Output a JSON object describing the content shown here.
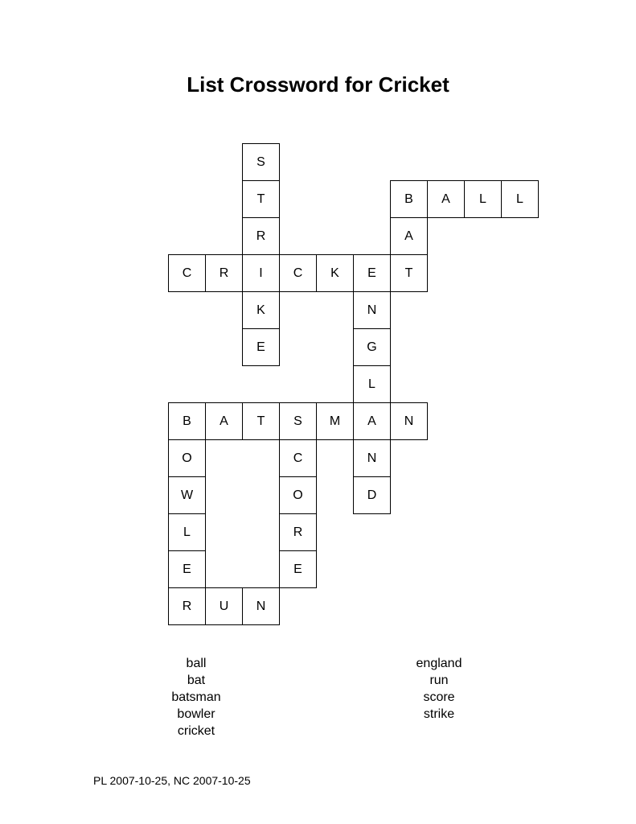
{
  "title": "List Crossword for Cricket",
  "cells": [
    {
      "r": 0,
      "c": 2,
      "letter": "S"
    },
    {
      "r": 1,
      "c": 2,
      "letter": "T"
    },
    {
      "r": 1,
      "c": 6,
      "letter": "B"
    },
    {
      "r": 1,
      "c": 7,
      "letter": "A"
    },
    {
      "r": 1,
      "c": 8,
      "letter": "L"
    },
    {
      "r": 1,
      "c": 9,
      "letter": "L"
    },
    {
      "r": 2,
      "c": 2,
      "letter": "R"
    },
    {
      "r": 2,
      "c": 6,
      "letter": "A"
    },
    {
      "r": 3,
      "c": 0,
      "letter": "C"
    },
    {
      "r": 3,
      "c": 1,
      "letter": "R"
    },
    {
      "r": 3,
      "c": 2,
      "letter": "I"
    },
    {
      "r": 3,
      "c": 3,
      "letter": "C"
    },
    {
      "r": 3,
      "c": 4,
      "letter": "K"
    },
    {
      "r": 3,
      "c": 5,
      "letter": "E"
    },
    {
      "r": 3,
      "c": 6,
      "letter": "T"
    },
    {
      "r": 4,
      "c": 2,
      "letter": "K"
    },
    {
      "r": 4,
      "c": 5,
      "letter": "N"
    },
    {
      "r": 5,
      "c": 2,
      "letter": "E"
    },
    {
      "r": 5,
      "c": 5,
      "letter": "G"
    },
    {
      "r": 6,
      "c": 5,
      "letter": "L"
    },
    {
      "r": 7,
      "c": 0,
      "letter": "B"
    },
    {
      "r": 7,
      "c": 1,
      "letter": "A"
    },
    {
      "r": 7,
      "c": 2,
      "letter": "T"
    },
    {
      "r": 7,
      "c": 3,
      "letter": "S"
    },
    {
      "r": 7,
      "c": 4,
      "letter": "M"
    },
    {
      "r": 7,
      "c": 5,
      "letter": "A"
    },
    {
      "r": 7,
      "c": 6,
      "letter": "N"
    },
    {
      "r": 8,
      "c": 0,
      "letter": "O"
    },
    {
      "r": 8,
      "c": 3,
      "letter": "C"
    },
    {
      "r": 8,
      "c": 5,
      "letter": "N"
    },
    {
      "r": 9,
      "c": 0,
      "letter": "W"
    },
    {
      "r": 9,
      "c": 3,
      "letter": "O"
    },
    {
      "r": 9,
      "c": 5,
      "letter": "D"
    },
    {
      "r": 10,
      "c": 0,
      "letter": "L"
    },
    {
      "r": 10,
      "c": 3,
      "letter": "R"
    },
    {
      "r": 11,
      "c": 0,
      "letter": "E"
    },
    {
      "r": 11,
      "c": 3,
      "letter": "E"
    },
    {
      "r": 12,
      "c": 0,
      "letter": "R"
    },
    {
      "r": 12,
      "c": 1,
      "letter": "U"
    },
    {
      "r": 12,
      "c": 2,
      "letter": "N"
    }
  ],
  "word_list_left": [
    "ball",
    "bat",
    "batsman",
    "bowler",
    "cricket"
  ],
  "word_list_right": [
    "england",
    "run",
    "score",
    "strike"
  ],
  "footer": "PL 2007-10-25, NC 2007-10-25"
}
